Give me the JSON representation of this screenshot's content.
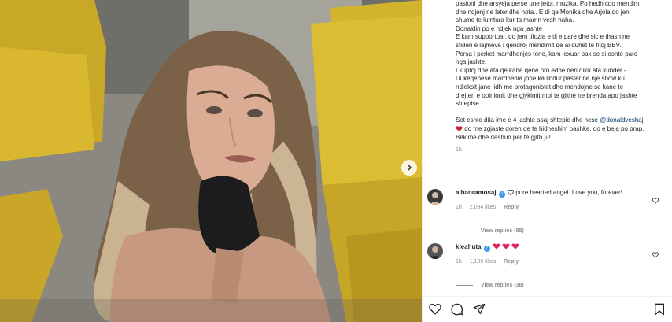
{
  "post": {
    "caption_lines": [
      "pasioni dhe arsyeja perse une jetoj, muzika. Po hedh cdo mendim",
      "dhe ndjenj ne leter dhe nota.. E di qe Monika dhe Arjola do jen",
      "shume te lumtura kur ta marrin vesh haha.",
      "Donaldin po e ndjek nga jashte",
      "E kam supportuar, do jem tifozja e tij e pare dhe sic e thash ne",
      "sfiden e lajmeve i qendroj mendimit qe ai duhet te fitoj BBV.",
      "Persa i perket marrdhenjes tone, kam lexuar pak se si eshte pare",
      "nga jashte.",
      "I kuptoj dhe ata qe kane qene pro edhe deri diku ata kunder -",
      "Dukeqenese mardhenia jone ka lindur paster ne nje show ku",
      "ndjeksit jane lidh me protagonistet dhe mendojne se kane te",
      "drejten e opinionit dhe gjykimit mbi te gjithe ne brenda apo jashte",
      "shtepise."
    ],
    "final_line_before": "Sot eshte dita ime e 4 jashte asaj shtepie dhe nese ",
    "final_mention": "@donaldveshaj",
    "final_line_after": " do me zgjaste doren qe te hidheshim bashke, do e beja po prap.",
    "closing": "Bekime dhe dashuri per te gjith ju!",
    "time": "1h"
  },
  "comments": [
    {
      "username": "albanramosaj",
      "verified": true,
      "text": "pure hearted angel. Love you, forever!",
      "time": "1h",
      "likes": "2,094 likes",
      "reply": "Reply",
      "view_replies": "View replies (65)"
    },
    {
      "username": "kleahuta",
      "verified": true,
      "text": "",
      "time": "1h",
      "likes": "1,139 likes",
      "reply": "Reply",
      "view_replies": "View replies (36)"
    }
  ],
  "icons": [
    "chevron-right-icon",
    "heart-icon",
    "comment-icon",
    "share-icon",
    "bookmark-icon",
    "verified-icon",
    "lips-emoji-icon",
    "red-heart-emoji-icon"
  ],
  "colors": {
    "verified": "#3897f0",
    "link": "#00376b",
    "muted": "#8e8e8e",
    "text": "#262626"
  }
}
